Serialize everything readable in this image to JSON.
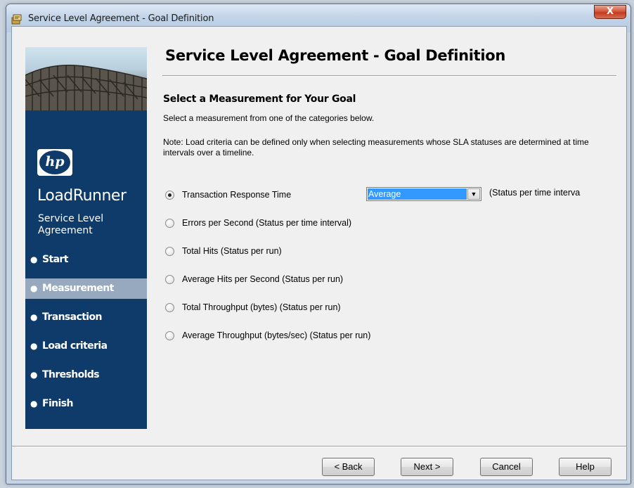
{
  "window": {
    "title": "Service Level Agreement - Goal Definition",
    "close_label": "X"
  },
  "sidebar": {
    "logo_text": "hp",
    "product": "LoadRunner",
    "subtitle": "Service Level Agreement",
    "steps": [
      {
        "label": "Start",
        "active": false
      },
      {
        "label": "Measurement",
        "active": true
      },
      {
        "label": "Transaction",
        "active": false
      },
      {
        "label": "Load criteria",
        "active": false
      },
      {
        "label": "Thresholds",
        "active": false
      },
      {
        "label": "Finish",
        "active": false
      }
    ]
  },
  "main": {
    "title": "Service Level Agreement - Goal Definition",
    "section_title": "Select a Measurement for Your Goal",
    "description": "Select a measurement from one of the categories below.",
    "note": "Note: Load criteria can be defined only when selecting measurements whose SLA statuses are determined at time intervals over a timeline.",
    "options": [
      {
        "label": "Transaction Response Time",
        "checked": true
      },
      {
        "label": "Errors per Second (Status per time interval)",
        "checked": false
      },
      {
        "label": "Total Hits (Status per run)",
        "checked": false
      },
      {
        "label": "Average Hits per Second (Status per run)",
        "checked": false
      },
      {
        "label": "Total Throughput (bytes) (Status per run)",
        "checked": false
      },
      {
        "label": "Average Throughput (bytes/sec) (Status per run)",
        "checked": false
      }
    ],
    "aggregation": {
      "selected": "Average",
      "hint": "(Status per time interva"
    }
  },
  "buttons": {
    "back": "< Back",
    "next": "Next >",
    "cancel": "Cancel",
    "help": "Help"
  },
  "colors": {
    "sidebar_bg": "#0f3b6b",
    "active_step_bg": "#97a9bf",
    "selection_blue": "#3399ff",
    "close_red": "#c03b1f"
  }
}
